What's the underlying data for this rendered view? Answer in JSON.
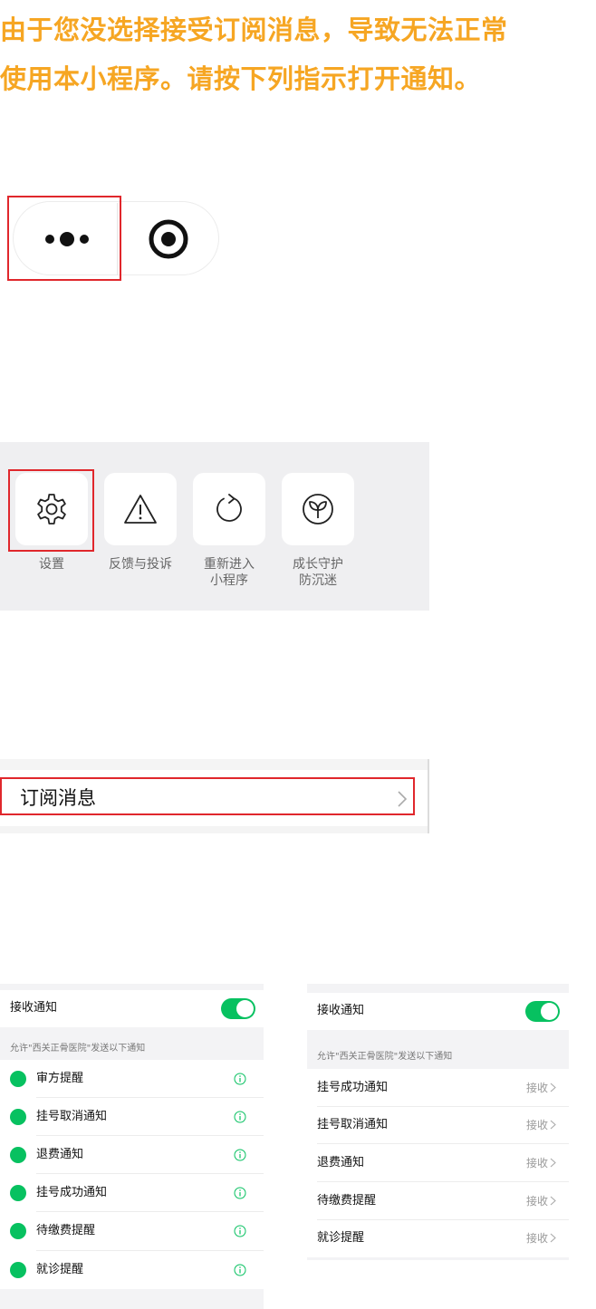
{
  "instruction": {
    "text": "由于您没选择接受订阅消息，导致无法正常\n使用本小程序。请按下列指示打开通知。",
    "color": "#f6a623"
  },
  "capsule": {
    "more_icon": "more-dots-icon",
    "close_icon": "target-close-icon",
    "highlight_color": "#e0272c"
  },
  "menu": {
    "items": [
      {
        "label": "设置",
        "icon": "gear-icon"
      },
      {
        "label": "反馈与投诉",
        "icon": "warning-triangle-icon"
      },
      {
        "label": "重新进入\n小程序",
        "icon": "reload-icon"
      },
      {
        "label": "成长守护\n防沉迷",
        "icon": "sprout-icon"
      }
    ]
  },
  "subscription": {
    "label": "订阅消息",
    "icon": "chevron-right-icon"
  },
  "left_panel": {
    "receive_label": "接收通知",
    "receive_on": true,
    "caption": "允许\"西关正骨医院\"发送以下通知",
    "items": [
      "审方提醒",
      "挂号取消通知",
      "退费通知",
      "挂号成功通知",
      "待缴费提醒",
      "就诊提醒"
    ]
  },
  "right_panel": {
    "receive_label": "接收通知",
    "receive_on": true,
    "caption": "允许\"西关正骨医院\"发送以下通知",
    "accept_label": "接收",
    "items": [
      "挂号成功通知",
      "挂号取消通知",
      "退费通知",
      "待缴费提醒",
      "就诊提醒"
    ]
  },
  "colors": {
    "toggle_on": "#07c160",
    "highlight": "#e0272c"
  }
}
